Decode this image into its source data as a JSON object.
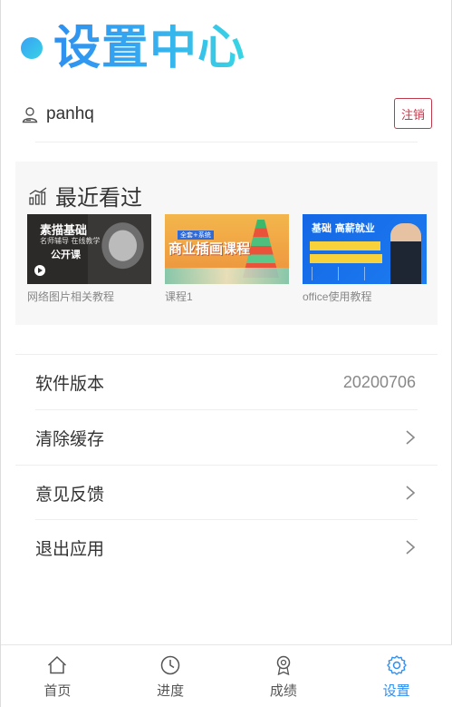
{
  "header": {
    "title": "设置中心"
  },
  "user": {
    "name": "panhq",
    "logout_label": "注销"
  },
  "recent": {
    "title": "最近看过",
    "courses": [
      {
        "name": "网络图片相关教程",
        "thumb_lines": [
          "素描基础",
          "名师辅导 在线教学",
          "公开课"
        ]
      },
      {
        "name": "课程1",
        "thumb_lines": [
          "全套+系统",
          "商业插画课程"
        ]
      },
      {
        "name": "office使用教程",
        "thumb_lines": [
          "基础 高薪就业"
        ]
      }
    ]
  },
  "menu": {
    "items": [
      {
        "label": "软件版本",
        "value": "20200706"
      },
      {
        "label": "清除缓存"
      },
      {
        "label": "意见反馈"
      },
      {
        "label": "退出应用"
      }
    ]
  },
  "tabbar": {
    "tabs": [
      {
        "label": "首页",
        "icon": "home-icon"
      },
      {
        "label": "进度",
        "icon": "clock-icon"
      },
      {
        "label": "成绩",
        "icon": "medal-icon"
      },
      {
        "label": "设置",
        "icon": "gear-icon"
      }
    ],
    "active_index": 3,
    "active_color": "#2f8fef",
    "inactive_color": "#555555"
  },
  "colors": {
    "logout": "#c0394b",
    "accent": "#2f8fef"
  }
}
